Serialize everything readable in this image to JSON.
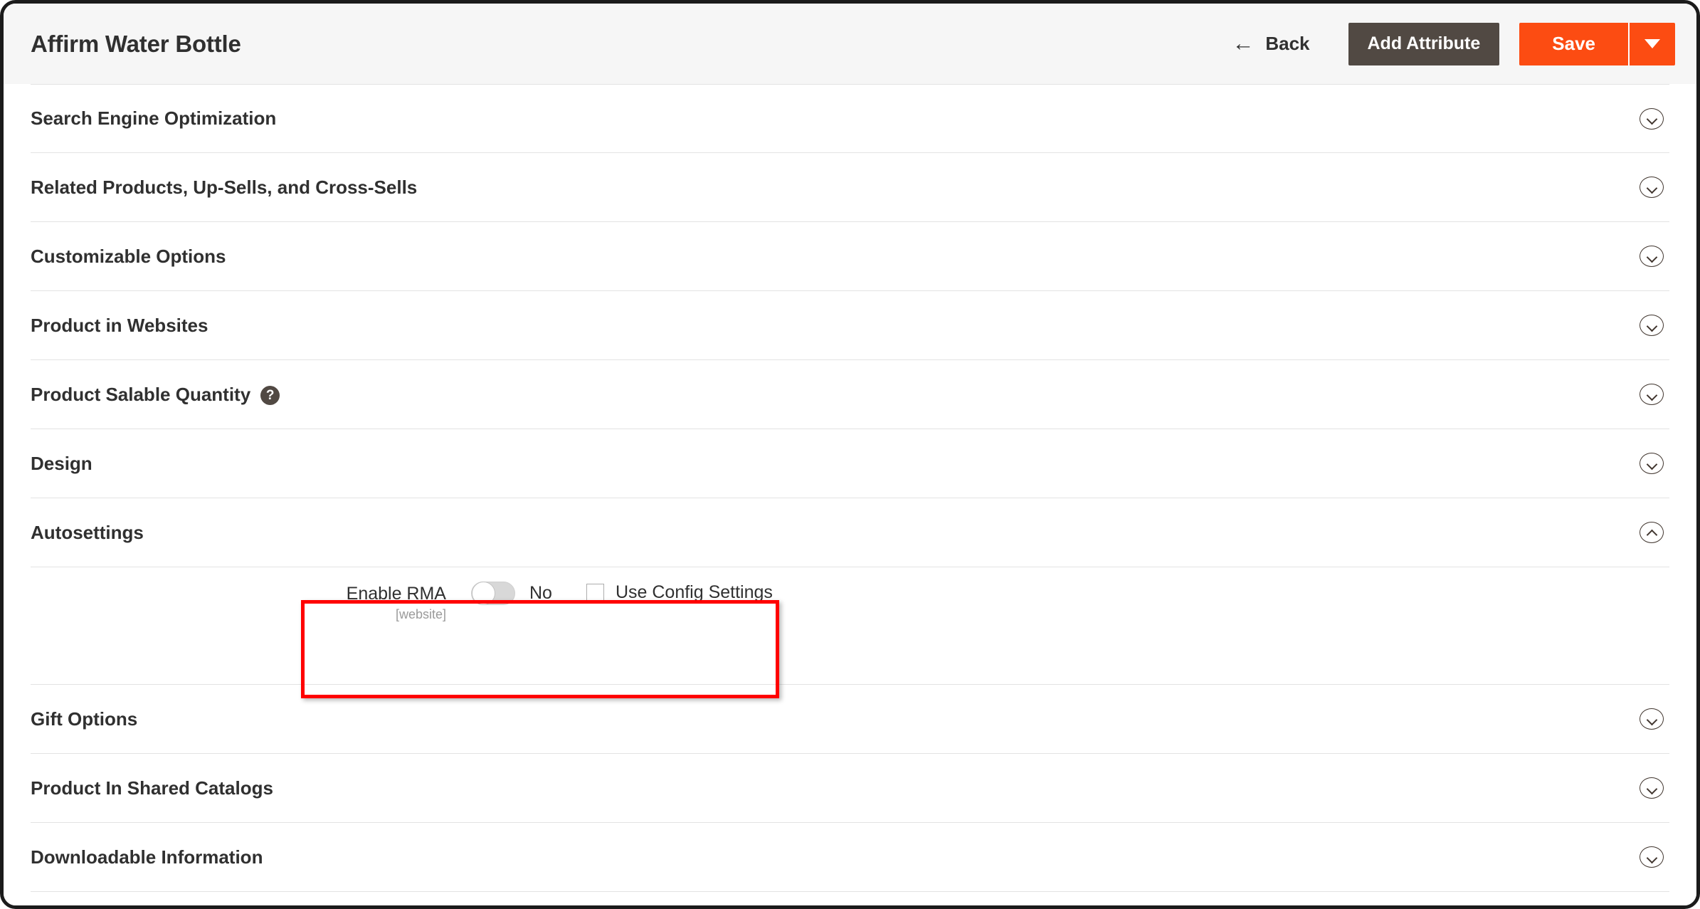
{
  "header": {
    "title": "Affirm Water Bottle",
    "back_label": "Back",
    "back_icon": "arrow-left-icon",
    "add_attribute_label": "Add Attribute",
    "save_label": "Save",
    "save_dropdown_icon": "caret-down-icon",
    "colors": {
      "header_bg": "#f6f6f6",
      "add_attribute_bg": "#514943",
      "save_bg": "#fc4c12",
      "title_color": "#303030"
    }
  },
  "sections": [
    {
      "title": "Search Engine Optimization",
      "expanded": false,
      "toggle_icon": "chevron-down-icon",
      "help_icon": false
    },
    {
      "title": "Related Products, Up-Sells, and Cross-Sells",
      "expanded": false,
      "toggle_icon": "chevron-down-icon",
      "help_icon": false
    },
    {
      "title": "Customizable Options",
      "expanded": false,
      "toggle_icon": "chevron-down-icon",
      "help_icon": false
    },
    {
      "title": "Product in Websites",
      "expanded": false,
      "toggle_icon": "chevron-down-icon",
      "help_icon": false
    },
    {
      "title": "Product Salable Quantity",
      "expanded": false,
      "toggle_icon": "chevron-down-icon",
      "help_icon": true,
      "help_glyph": "?"
    },
    {
      "title": "Design",
      "expanded": false,
      "toggle_icon": "chevron-down-icon",
      "help_icon": false
    },
    {
      "title": "Autosettings",
      "expanded": true,
      "toggle_icon": "chevron-up-icon",
      "help_icon": false
    },
    {
      "title": "Gift Options",
      "expanded": false,
      "toggle_icon": "chevron-down-icon",
      "help_icon": false
    },
    {
      "title": "Product In Shared Catalogs",
      "expanded": false,
      "toggle_icon": "chevron-down-icon",
      "help_icon": false
    },
    {
      "title": "Downloadable Information",
      "expanded": false,
      "toggle_icon": "chevron-down-icon",
      "help_icon": false
    }
  ],
  "autosettings": {
    "enable_rma": {
      "label": "Enable RMA",
      "scope": "[website]",
      "toggle_state": "off",
      "value": "No",
      "use_config_label": "Use Config Settings",
      "use_config_checked": false
    }
  },
  "annotation": {
    "color": "#ff0000",
    "target": "enable-rma-field"
  }
}
